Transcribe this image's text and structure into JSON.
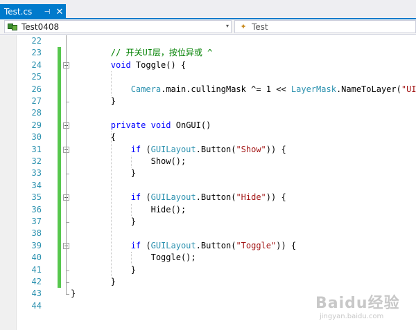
{
  "tab": {
    "label": "Test.cs",
    "pin_glyph": "⊣",
    "close_glyph": "✕"
  },
  "navbar": {
    "project": "Test0408",
    "class": "Test",
    "dropdown_glyph": "▾",
    "class_icon_glyph": "✦"
  },
  "code_lines": [
    {
      "n": "22",
      "tokens": []
    },
    {
      "n": "23",
      "tokens": [
        {
          "t": "        "
        },
        {
          "c": "cm",
          "t": "// 开关UI层，按位异或 ^"
        }
      ]
    },
    {
      "n": "24",
      "tokens": [
        {
          "t": "        "
        },
        {
          "c": "kw",
          "t": "void"
        },
        {
          "t": " Toggle() {"
        }
      ]
    },
    {
      "n": "25",
      "tokens": []
    },
    {
      "n": "26",
      "tokens": [
        {
          "t": "            "
        },
        {
          "c": "ty",
          "t": "Camera"
        },
        {
          "t": ".main.cullingMask ^= 1 << "
        },
        {
          "c": "ty",
          "t": "LayerMask"
        },
        {
          "t": ".NameToLayer("
        },
        {
          "c": "st",
          "t": "\"UI\""
        },
        {
          "t": ");"
        }
      ]
    },
    {
      "n": "27",
      "tokens": [
        {
          "t": "        }"
        }
      ]
    },
    {
      "n": "28",
      "tokens": []
    },
    {
      "n": "29",
      "tokens": [
        {
          "t": "        "
        },
        {
          "c": "kw",
          "t": "private"
        },
        {
          "t": " "
        },
        {
          "c": "kw",
          "t": "void"
        },
        {
          "t": " OnGUI()"
        }
      ]
    },
    {
      "n": "30",
      "tokens": [
        {
          "t": "        {"
        }
      ]
    },
    {
      "n": "31",
      "tokens": [
        {
          "t": "            "
        },
        {
          "c": "kw",
          "t": "if"
        },
        {
          "t": " ("
        },
        {
          "c": "ty",
          "t": "GUILayout"
        },
        {
          "t": ".Button("
        },
        {
          "c": "st",
          "t": "\"Show\""
        },
        {
          "t": ")) {"
        }
      ]
    },
    {
      "n": "32",
      "tokens": [
        {
          "t": "                Show();"
        }
      ]
    },
    {
      "n": "33",
      "tokens": [
        {
          "t": "            }"
        }
      ]
    },
    {
      "n": "34",
      "tokens": []
    },
    {
      "n": "35",
      "tokens": [
        {
          "t": "            "
        },
        {
          "c": "kw",
          "t": "if"
        },
        {
          "t": " ("
        },
        {
          "c": "ty",
          "t": "GUILayout"
        },
        {
          "t": ".Button("
        },
        {
          "c": "st",
          "t": "\"Hide\""
        },
        {
          "t": ")) {"
        }
      ]
    },
    {
      "n": "36",
      "tokens": [
        {
          "t": "                Hide();"
        }
      ]
    },
    {
      "n": "37",
      "tokens": [
        {
          "t": "            }"
        }
      ]
    },
    {
      "n": "38",
      "tokens": []
    },
    {
      "n": "39",
      "tokens": [
        {
          "t": "            "
        },
        {
          "c": "kw",
          "t": "if"
        },
        {
          "t": " ("
        },
        {
          "c": "ty",
          "t": "GUILayout"
        },
        {
          "t": ".Button("
        },
        {
          "c": "st",
          "t": "\"Toggle\""
        },
        {
          "t": ")) {"
        }
      ]
    },
    {
      "n": "40",
      "tokens": [
        {
          "t": "                Toggle();"
        }
      ]
    },
    {
      "n": "41",
      "tokens": [
        {
          "t": "            }"
        }
      ]
    },
    {
      "n": "42",
      "tokens": [
        {
          "t": "        }"
        }
      ]
    },
    {
      "n": "43",
      "tokens": [
        {
          "t": "}"
        }
      ]
    },
    {
      "n": "44",
      "tokens": []
    }
  ],
  "watermark": {
    "main": "Baidu经验",
    "sub": "jingyan.baidu.com"
  },
  "colors": {
    "accent": "#007acc",
    "keyword": "#0000ff",
    "type": "#2b91af",
    "string": "#a31515",
    "comment": "#008000",
    "change_marker": "#57c74e"
  }
}
